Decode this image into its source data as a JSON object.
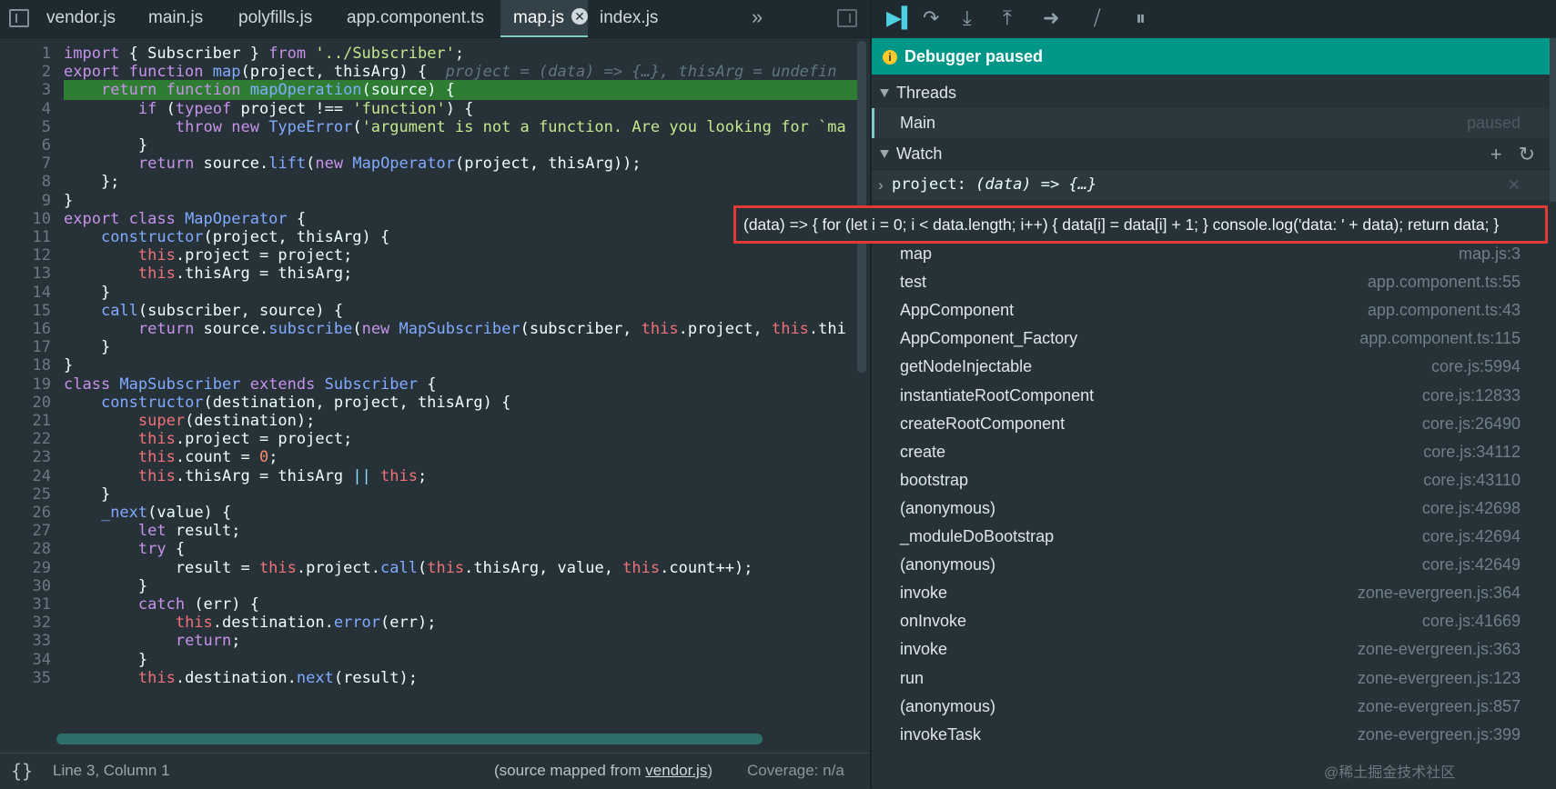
{
  "tabs": [
    {
      "label": "vendor.js",
      "active": false
    },
    {
      "label": "main.js",
      "active": false
    },
    {
      "label": "polyfills.js",
      "active": false
    },
    {
      "label": "app.component.ts",
      "active": false
    },
    {
      "label": "map.js",
      "active": true,
      "close": "✕"
    },
    {
      "label": "index.js",
      "active": false
    }
  ],
  "more_tabs": "»",
  "code": [
    {
      "n": "1",
      "t": [
        [
          "kw",
          "import "
        ],
        [
          "id",
          "{ Subscriber } "
        ],
        [
          "kw",
          "from "
        ],
        [
          "str",
          "'../Subscriber'"
        ],
        [
          "id",
          ";"
        ]
      ]
    },
    {
      "n": "2",
      "t": [
        [
          "kw",
          "export function "
        ],
        [
          "fn",
          "map"
        ],
        [
          "id",
          "(project, thisArg) {"
        ],
        [
          "inl",
          "  project = (data) => {…}, thisArg = undefin"
        ]
      ]
    },
    {
      "n": "3",
      "hl": true,
      "t": [
        [
          "id",
          "    "
        ],
        [
          "kw",
          "return function "
        ],
        [
          "fn",
          "mapOperation"
        ],
        [
          "id",
          "(source) {"
        ]
      ]
    },
    {
      "n": "4",
      "t": [
        [
          "id",
          "        "
        ],
        [
          "kw",
          "if "
        ],
        [
          "id",
          "("
        ],
        [
          "kw",
          "typeof "
        ],
        [
          "id",
          "project !== "
        ],
        [
          "str",
          "'function'"
        ],
        [
          "id",
          ") {"
        ]
      ]
    },
    {
      "n": "5",
      "t": [
        [
          "id",
          "            "
        ],
        [
          "kw",
          "throw new "
        ],
        [
          "fn",
          "TypeError"
        ],
        [
          "id",
          "("
        ],
        [
          "str",
          "'argument is not a function. Are you looking for `ma"
        ]
      ]
    },
    {
      "n": "6",
      "t": [
        [
          "id",
          "        }"
        ]
      ]
    },
    {
      "n": "7",
      "t": [
        [
          "id",
          "        "
        ],
        [
          "kw",
          "return "
        ],
        [
          "id",
          "source."
        ],
        [
          "fn",
          "lift"
        ],
        [
          "id",
          "("
        ],
        [
          "kw",
          "new "
        ],
        [
          "fn",
          "MapOperator"
        ],
        [
          "id",
          "(project, thisArg));"
        ]
      ]
    },
    {
      "n": "8",
      "t": [
        [
          "id",
          "    };"
        ]
      ]
    },
    {
      "n": "9",
      "t": [
        [
          "id",
          "}"
        ]
      ]
    },
    {
      "n": "10",
      "t": [
        [
          "kw",
          "export class "
        ],
        [
          "fn",
          "MapOperator "
        ],
        [
          "id",
          "{"
        ]
      ]
    },
    {
      "n": "11",
      "t": [
        [
          "id",
          "    "
        ],
        [
          "fn",
          "constructor"
        ],
        [
          "id",
          "(project, thisArg) {"
        ]
      ]
    },
    {
      "n": "12",
      "t": [
        [
          "id",
          "        "
        ],
        [
          "th",
          "this"
        ],
        [
          "id",
          ".project = project;"
        ]
      ]
    },
    {
      "n": "13",
      "t": [
        [
          "id",
          "        "
        ],
        [
          "th",
          "this"
        ],
        [
          "id",
          ".thisArg = thisArg;"
        ]
      ]
    },
    {
      "n": "14",
      "t": [
        [
          "id",
          "    }"
        ]
      ]
    },
    {
      "n": "15",
      "t": [
        [
          "id",
          "    "
        ],
        [
          "fn",
          "call"
        ],
        [
          "id",
          "(subscriber, source) {"
        ]
      ]
    },
    {
      "n": "16",
      "t": [
        [
          "id",
          "        "
        ],
        [
          "kw",
          "return "
        ],
        [
          "id",
          "source."
        ],
        [
          "fn",
          "subscribe"
        ],
        [
          "id",
          "("
        ],
        [
          "kw",
          "new "
        ],
        [
          "fn",
          "MapSubscriber"
        ],
        [
          "id",
          "(subscriber, "
        ],
        [
          "th",
          "this"
        ],
        [
          "id",
          ".project, "
        ],
        [
          "th",
          "this"
        ],
        [
          "id",
          ".thi"
        ]
      ]
    },
    {
      "n": "17",
      "t": [
        [
          "id",
          "    }"
        ]
      ]
    },
    {
      "n": "18",
      "t": [
        [
          "id",
          "}"
        ]
      ]
    },
    {
      "n": "19",
      "t": [
        [
          "kw",
          "class "
        ],
        [
          "fn",
          "MapSubscriber "
        ],
        [
          "kw",
          "extends "
        ],
        [
          "fn",
          "Subscriber "
        ],
        [
          "id",
          "{"
        ]
      ]
    },
    {
      "n": "20",
      "t": [
        [
          "id",
          "    "
        ],
        [
          "fn",
          "constructor"
        ],
        [
          "id",
          "(destination, project, thisArg) {"
        ]
      ]
    },
    {
      "n": "21",
      "t": [
        [
          "id",
          "        "
        ],
        [
          "th",
          "super"
        ],
        [
          "id",
          "(destination);"
        ]
      ]
    },
    {
      "n": "22",
      "t": [
        [
          "id",
          "        "
        ],
        [
          "th",
          "this"
        ],
        [
          "id",
          ".project = project;"
        ]
      ]
    },
    {
      "n": "23",
      "t": [
        [
          "id",
          "        "
        ],
        [
          "th",
          "this"
        ],
        [
          "id",
          ".count = "
        ],
        [
          "num",
          "0"
        ],
        [
          "id",
          ";"
        ]
      ]
    },
    {
      "n": "24",
      "t": [
        [
          "id",
          "        "
        ],
        [
          "th",
          "this"
        ],
        [
          "id",
          ".thisArg = thisArg "
        ],
        [
          "pn",
          "|| "
        ],
        [
          "th",
          "this"
        ],
        [
          "id",
          ";"
        ]
      ]
    },
    {
      "n": "25",
      "t": [
        [
          "id",
          "    }"
        ]
      ]
    },
    {
      "n": "26",
      "t": [
        [
          "id",
          "    "
        ],
        [
          "fn",
          "_next"
        ],
        [
          "id",
          "(value) {"
        ]
      ]
    },
    {
      "n": "27",
      "t": [
        [
          "id",
          "        "
        ],
        [
          "kw",
          "let "
        ],
        [
          "id",
          "result;"
        ]
      ]
    },
    {
      "n": "28",
      "t": [
        [
          "id",
          "        "
        ],
        [
          "kw",
          "try "
        ],
        [
          "id",
          "{"
        ]
      ]
    },
    {
      "n": "29",
      "t": [
        [
          "id",
          "            result = "
        ],
        [
          "th",
          "this"
        ],
        [
          "id",
          ".project."
        ],
        [
          "fn",
          "call"
        ],
        [
          "id",
          "("
        ],
        [
          "th",
          "this"
        ],
        [
          "id",
          ".thisArg, value, "
        ],
        [
          "th",
          "this"
        ],
        [
          "id",
          ".count++);"
        ]
      ]
    },
    {
      "n": "30",
      "t": [
        [
          "id",
          "        }"
        ]
      ]
    },
    {
      "n": "31",
      "t": [
        [
          "id",
          "        "
        ],
        [
          "kw",
          "catch "
        ],
        [
          "id",
          "(err) {"
        ]
      ]
    },
    {
      "n": "32",
      "t": [
        [
          "id",
          "            "
        ],
        [
          "th",
          "this"
        ],
        [
          "id",
          ".destination."
        ],
        [
          "fn",
          "error"
        ],
        [
          "id",
          "(err);"
        ]
      ]
    },
    {
      "n": "33",
      "t": [
        [
          "id",
          "            "
        ],
        [
          "kw",
          "return"
        ],
        [
          "id",
          ";"
        ]
      ]
    },
    {
      "n": "34",
      "t": [
        [
          "id",
          "        }"
        ]
      ]
    },
    {
      "n": "35",
      "t": [
        [
          "id",
          "        "
        ],
        [
          "th",
          "this"
        ],
        [
          "id",
          ".destination."
        ],
        [
          "fn",
          "next"
        ],
        [
          "id",
          "(result);"
        ]
      ]
    }
  ],
  "status": {
    "brace": "{}",
    "position": "Line 3, Column 1",
    "source_prefix": "(source mapped from ",
    "source_link": "vendor.js",
    "source_suffix": ")",
    "coverage": "Coverage: n/a"
  },
  "debugger": {
    "paused_label": "Debugger paused",
    "threads_label": "Threads",
    "thread_name": "Main",
    "thread_state": "paused",
    "watch_label": "Watch",
    "watch_add": "+",
    "watch_refresh": "↻",
    "watch_expr": "project: ",
    "watch_value": "(data) => {…}",
    "watch_remove": "✕",
    "tooltip": "(data) => { for (let i = 0; i < data.length; i++) { data[i] = data[i] + 1; } console.log('data: ' + data); return data; }"
  },
  "frames": [
    {
      "name": "map",
      "loc": "map.js:3"
    },
    {
      "name": "test",
      "loc": "app.component.ts:55"
    },
    {
      "name": "AppComponent",
      "loc": "app.component.ts:43"
    },
    {
      "name": "AppComponent_Factory",
      "loc": "app.component.ts:115"
    },
    {
      "name": "getNodeInjectable",
      "loc": "core.js:5994"
    },
    {
      "name": "instantiateRootComponent",
      "loc": "core.js:12833"
    },
    {
      "name": "createRootComponent",
      "loc": "core.js:26490"
    },
    {
      "name": "create",
      "loc": "core.js:34112"
    },
    {
      "name": "bootstrap",
      "loc": "core.js:43110"
    },
    {
      "name": "(anonymous)",
      "loc": "core.js:42698"
    },
    {
      "name": "_moduleDoBootstrap",
      "loc": "core.js:42694"
    },
    {
      "name": "(anonymous)",
      "loc": "core.js:42649"
    },
    {
      "name": "invoke",
      "loc": "zone-evergreen.js:364"
    },
    {
      "name": "onInvoke",
      "loc": "core.js:41669"
    },
    {
      "name": "invoke",
      "loc": "zone-evergreen.js:363"
    },
    {
      "name": "run",
      "loc": "zone-evergreen.js:123"
    },
    {
      "name": "(anonymous)",
      "loc": "zone-evergreen.js:857"
    },
    {
      "name": "invokeTask",
      "loc": "zone-evergreen.js:399"
    }
  ],
  "watermark": "@稀土掘金技术社区",
  "colors": {
    "accent": "#009688",
    "highlight_line": "#2e7d32",
    "tooltip_border": "#e53935"
  }
}
